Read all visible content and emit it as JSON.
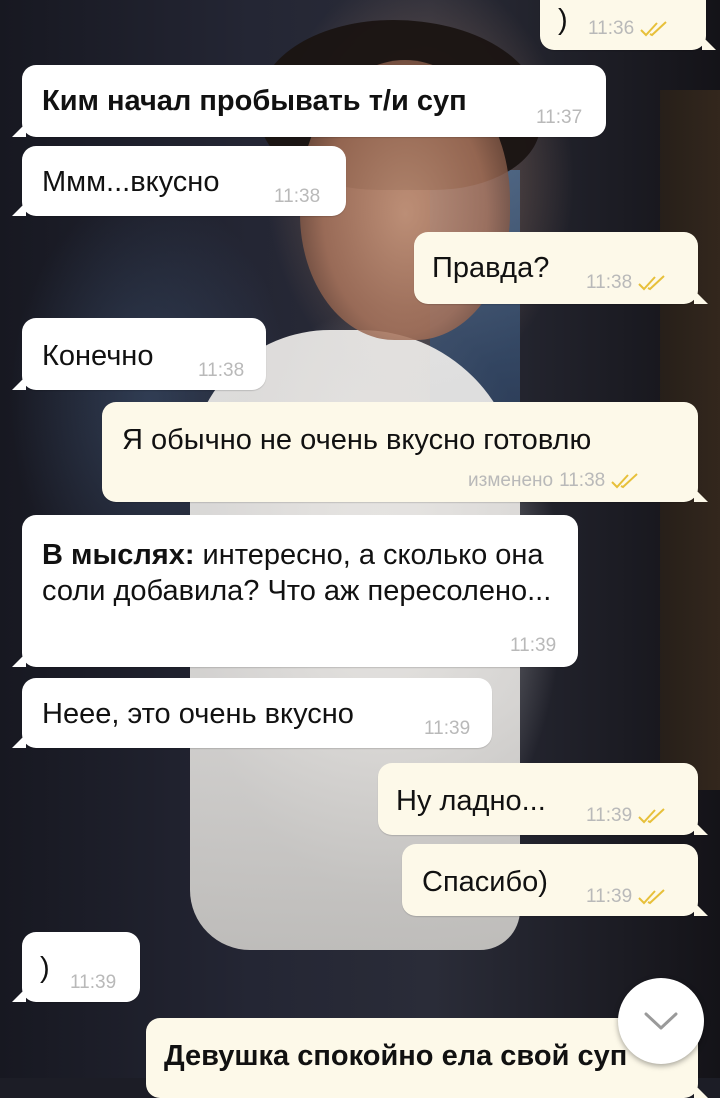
{
  "messages": [
    {
      "id": "m0",
      "dir": "out",
      "text": ")",
      "time": "11:36",
      "read": true
    },
    {
      "id": "m1",
      "dir": "in",
      "text": "Ким начал пробывать т/и суп",
      "bold": true,
      "time": "11:37"
    },
    {
      "id": "m2",
      "dir": "in",
      "text": "Ммм...вкусно",
      "time": "11:38"
    },
    {
      "id": "m3",
      "dir": "out",
      "text": "Правда?",
      "time": "11:38",
      "read": true
    },
    {
      "id": "m4",
      "dir": "in",
      "text": "Конечно",
      "time": "11:38"
    },
    {
      "id": "m5",
      "dir": "out",
      "text": "Я обычно не очень вкусно готовлю",
      "edited": "изменено",
      "time": "11:38",
      "read": true
    },
    {
      "id": "m6",
      "dir": "in",
      "prefix": "В мыслях:",
      "text": " интересно, а сколько она соли добавила? Что аж пересолено...",
      "time": "11:39"
    },
    {
      "id": "m7",
      "dir": "in",
      "text": "Неее, это очень вкусно",
      "time": "11:39"
    },
    {
      "id": "m8",
      "dir": "out",
      "text": "Ну ладно...",
      "time": "11:39",
      "read": true
    },
    {
      "id": "m9",
      "dir": "out",
      "text": "Спасибо)",
      "time": "11:39",
      "read": true
    },
    {
      "id": "m10",
      "dir": "in",
      "text": ")",
      "time": "11:39"
    },
    {
      "id": "m11",
      "dir": "in",
      "text": "Девушка спокойно ела свой суп",
      "bold": true,
      "time": ""
    }
  ],
  "scroll_button": {
    "icon": "chevron-down-icon"
  },
  "colors": {
    "incoming": "#ffffff",
    "outgoing": "#fdf9e9",
    "read_ticks": "#e7c03a",
    "meta": "#b9b9b9"
  }
}
